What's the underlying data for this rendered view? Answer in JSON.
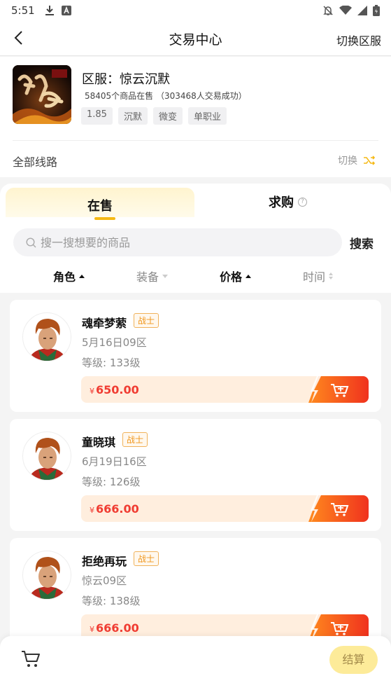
{
  "status_bar": {
    "time": "5:51"
  },
  "nav": {
    "title": "交易中心",
    "switch_server": "切换区服"
  },
  "server": {
    "name": "区服：惊云沉默",
    "stats": "58405个商品在售 （303468人交易成功）",
    "tags": [
      "1.85",
      "沉默",
      "微变",
      "单职业"
    ],
    "all_lines": "全部线路",
    "switch_line": "切换"
  },
  "tabs": {
    "sell": "在售",
    "buy": "求购"
  },
  "search": {
    "placeholder": "搜一搜想要的商品",
    "button": "搜索"
  },
  "sorts": {
    "role": "角色",
    "equip": "装备",
    "price": "价格",
    "time": "时间"
  },
  "items": [
    {
      "name": "魂牵梦萦",
      "class": "战士",
      "server": "5月16日09区",
      "level": "等级: 133级",
      "currency": "¥",
      "price": "650.00"
    },
    {
      "name": "童晓琪",
      "class": "战士",
      "server": "6月19日16区",
      "level": "等级: 126级",
      "currency": "¥",
      "price": "666.00"
    },
    {
      "name": "拒绝再玩",
      "class": "战士",
      "server": "惊云09区",
      "level": "等级: 138级",
      "currency": "¥",
      "price": "666.00"
    }
  ],
  "bottom": {
    "checkout": "结算"
  },
  "colors": {
    "accent": "#f5b915",
    "price": "#f03c32",
    "cart_gradient_start": "#ff8a1e",
    "cart_gradient_end": "#f0321e"
  }
}
